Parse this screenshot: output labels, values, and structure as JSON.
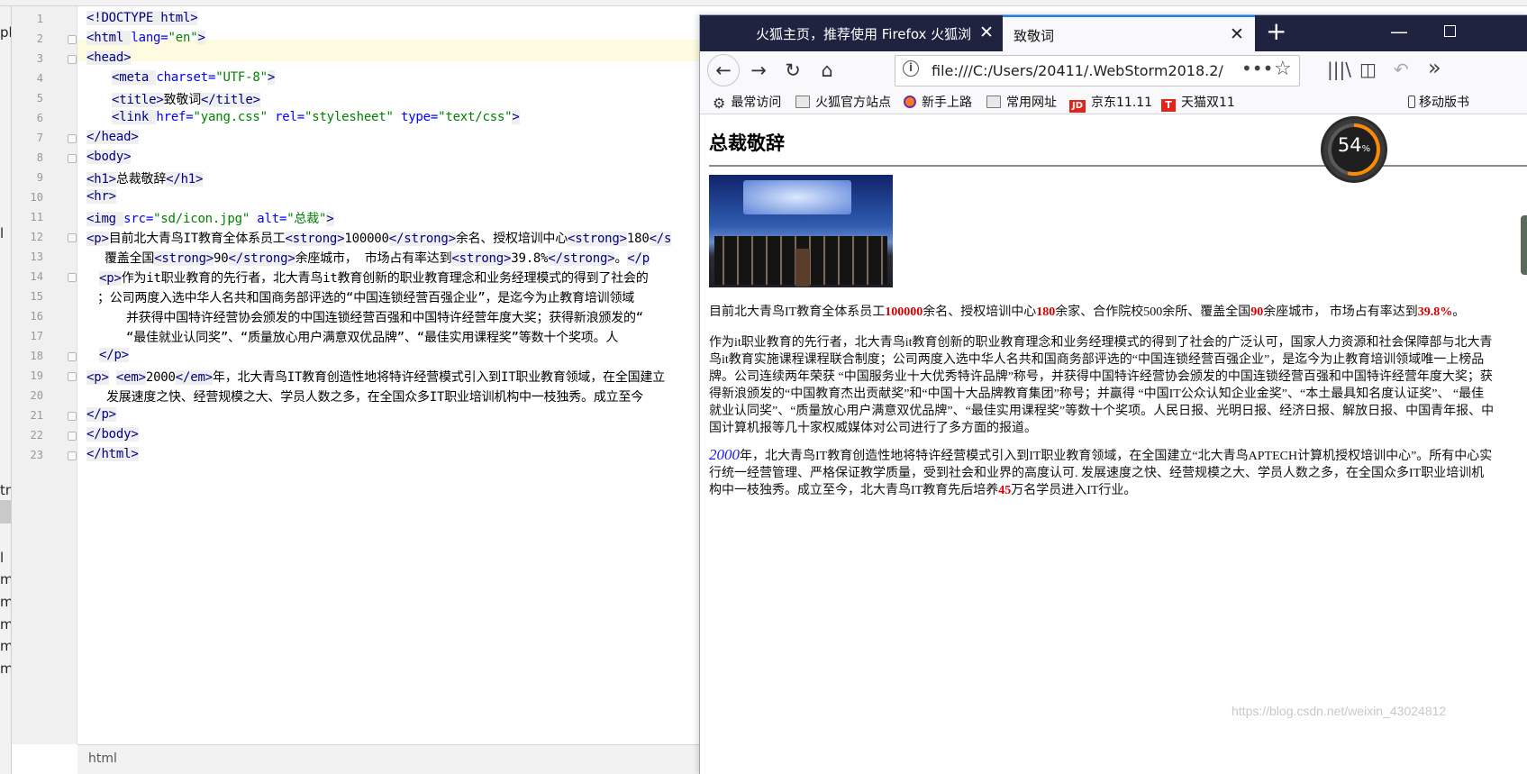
{
  "ide": {
    "breadcrumb": "html",
    "strip_fragments": [
      "ple",
      "l",
      "tm",
      "l",
      "ml",
      "ml",
      "ml",
      "ml",
      "ml"
    ],
    "line_numbers": [
      "1",
      "2",
      "3",
      "4",
      "5",
      "6",
      "7",
      "8",
      "9",
      "10",
      "11",
      "12",
      "13",
      "14",
      "15",
      "16",
      "17",
      "18",
      "19",
      "20",
      "21",
      "22",
      "23"
    ],
    "code": {
      "l1": {
        "tag": "<!DOCTYPE html>"
      },
      "l2": {
        "tag": "<html ",
        "attr": "lang=",
        "val": "\"en\"",
        "end": ">"
      },
      "l3": {
        "tag": "<head>"
      },
      "l4": {
        "tag": "<meta ",
        "attr": "charset=",
        "val": "\"UTF-8\"",
        "end": ">"
      },
      "l5": {
        "open": "<title>",
        "text": "致敬词",
        "close": "</title>"
      },
      "l6": {
        "tag": "<link ",
        "a1": "href=",
        "v1": "\"yang.css\" ",
        "a2": "rel=",
        "v2": "\"stylesheet\" ",
        "a3": "type=",
        "v3": "\"text/css\"",
        "end": ">"
      },
      "l7": {
        "tag": "</head>"
      },
      "l8": {
        "tag": "<body>"
      },
      "l9": {
        "open": "<h1>",
        "text": "总裁敬辞",
        "close": "</h1>"
      },
      "l10": {
        "tag": "<hr>"
      },
      "l11": {
        "tag": "<img ",
        "a1": "src=",
        "v1": "\"sd/icon.jpg\" ",
        "a2": "alt=",
        "v2": "\"总裁\"",
        "end": ">"
      },
      "l12": {
        "p": "<p>",
        "t1": "目前北大青鸟IT教育全体系员工",
        "s1": "<strong>",
        "t2": "100000",
        "s2": "</strong>",
        "t3": "余名、授权培训中心",
        "s3": "<strong>",
        "t4": "180",
        "s4": "</s"
      },
      "l13": {
        "t1": "覆盖全国",
        "s1": "<strong>",
        "t2": "90",
        "s2": "</strong>",
        "t3": "余座城市， 市场占有率达到",
        "s3": "<strong>",
        "t4": "39.8%",
        "s4": "</strong>",
        "t5": "。",
        "s5": "</p"
      },
      "l14": {
        "p": "<p>",
        "t1": "作为it职业教育的先行者，北大青鸟it教育创新的职业教育理念和业务经理模式的得到了社会的"
      },
      "l15": {
        "t1": "；公司两度入选中华人名共和国商务部评选的“中国连锁经营百强企业”，是迄今为止教育培训领域"
      },
      "l16": {
        "t1": "并获得中国特许经营协会颁发的中国连锁经营百强和中国特许经营年度大奖；获得新浪颁发的“"
      },
      "l17": {
        "t1": "“最佳就业认同奖”、“质量放心用户满意双优品牌”、“最佳实用课程奖”等数十个奖项。人"
      },
      "l18": {
        "tag": "</p>"
      },
      "l19": {
        "p": "<p>",
        "sp": " ",
        "e1": "<em>",
        "t1": "2000",
        "e2": "</em>",
        "t2": "年，北大青鸟IT教育创造性地将特许经营模式引入到IT职业教育领域，在全国建立"
      },
      "l20": {
        "t1": "发展速度之快、经营规模之大、学员人数之多，在全国众多IT职业培训机构中一枝独秀。成立至今"
      },
      "l21": {
        "tag": "</p>"
      },
      "l22": {
        "tag": "</body>"
      },
      "l23": {
        "tag": "</html>"
      }
    }
  },
  "firefox": {
    "tabs": [
      {
        "title": "火狐主页，推荐使用 Firefox 火狐浏",
        "close": "✕"
      },
      {
        "title": "致敬词",
        "close": "✕"
      }
    ],
    "new_tab": "+",
    "window_controls": {
      "minimize": "—"
    },
    "nav": {
      "back": "←",
      "forward": "→",
      "reload": "↻",
      "home": "⌂"
    },
    "url": "file:///C:/Users/20411/.WebStorm2018.2/",
    "url_info_icon": "i",
    "url_more": "•••",
    "url_star": "☆",
    "toolbar_icons": {
      "library": "|||\\",
      "sidebar": "◫",
      "undo": "↶",
      "overflow": "»"
    },
    "bookmarks": [
      {
        "label": "最常访问",
        "icon": "gear-icon"
      },
      {
        "label": "火狐官方站点",
        "icon": "folder-icon"
      },
      {
        "label": "新手上路",
        "icon": "firefox-icon"
      },
      {
        "label": "常用网址",
        "icon": "folder-icon"
      },
      {
        "label": "京东11.11",
        "icon": "jd-icon",
        "badge": "JD"
      },
      {
        "label": "天猫双11",
        "icon": "tmall-icon",
        "badge": "T"
      },
      {
        "label": "移动版书",
        "icon": "phone-icon"
      }
    ],
    "gauge": {
      "value": "54",
      "unit": "%",
      "fraction": 0.54
    },
    "page": {
      "h1": "总裁敬辞",
      "p1": {
        "t1": "目前北大青鸟IT教育全体系员工",
        "n1": "100000",
        "t2": "余名、授权培训中心",
        "n2": "180",
        "t3": "余家、合作院校500余所、覆盖全国",
        "n3": "90",
        "t4": "余座城市， 市场占有率达到",
        "n4": "39.8%",
        "t5": "。"
      },
      "p2_lines": [
        "作为it职业教育的先行者，北大青鸟it教育创新的职业教育理念和业务经理模式的得到了社会的广泛认可，国家人力资源和社会保障部与北大青",
        "鸟it教育实施课程课程联合制度；公司两度入选中华人名共和国商务部评选的“中国连锁经营百强企业”，是迄今为止教育培训领域唯一上榜品",
        "牌。公司连续两年荣获 “中国服务业十大优秀特许品牌”称号，并获得中国特许经营协会颁发的中国连锁经营百强和中国特许经营年度大奖；获",
        "得新浪颁发的“中国教育杰出贡献奖”和“中国十大品牌教育集团”称号；并赢得 “中国IT公众认知企业金奖”、“本土最具知名度认证奖”、 “最佳",
        "就业认同奖”、“质量放心用户满意双优品牌”、“最佳实用课程奖”等数十个奖项。人民日报、光明日报、经济日报、解放日报、中国青年报、中",
        "国计算机报等几十家权威媒体对公司进行了多方面的报道。"
      ],
      "p3": {
        "em": "2000",
        "l1": "年，北大青鸟IT教育创造性地将特许经营模式引入到IT职业教育领域，在全国建立“北大青鸟APTECH计算机授权培训中心”。所有中心实",
        "l2": "行统一经营管理、严格保证教学质量，受到社会和业界的高度认可. 发展速度之快、经营规模之大、学员人数之多，在全国众多IT职业培训机",
        "l3a": "构中一枝独秀。成立至今，北大青鸟IT教育先后培养",
        "n": "45",
        "l3b": "万名学员进入IT行业。"
      },
      "watermark": "https://blog.csdn.net/weixin_43024812"
    }
  }
}
